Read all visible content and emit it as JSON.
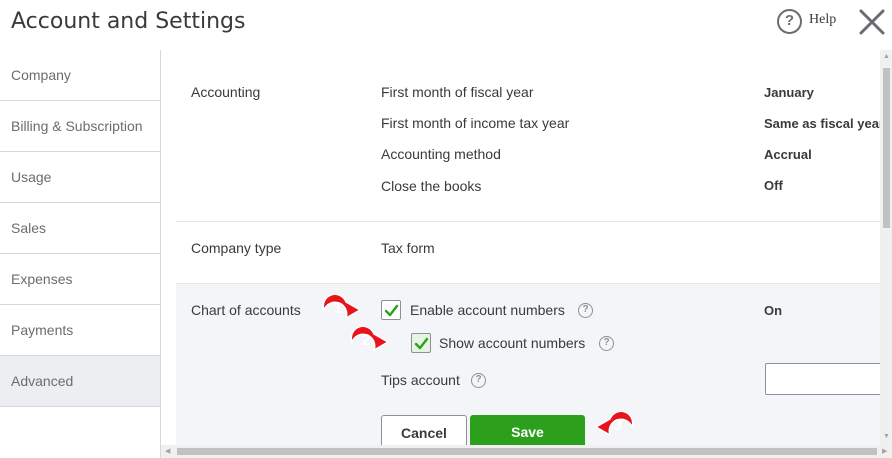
{
  "header": {
    "title": "Account and Settings",
    "help_label": "Help",
    "help_icon": "?",
    "close_icon": "close-icon"
  },
  "sidebar": {
    "items": [
      {
        "label": "Company"
      },
      {
        "label": "Billing & Subscription"
      },
      {
        "label": "Usage"
      },
      {
        "label": "Sales"
      },
      {
        "label": "Expenses"
      },
      {
        "label": "Payments"
      },
      {
        "label": "Advanced",
        "active": true
      }
    ]
  },
  "accounting": {
    "section_label": "Accounting",
    "rows": [
      {
        "label": "First month of fiscal year",
        "value": "January"
      },
      {
        "label": "First month of income tax year",
        "value": "Same as fiscal year"
      },
      {
        "label": "Accounting method",
        "value": "Accrual"
      },
      {
        "label": "Close the books",
        "value": "Off"
      }
    ]
  },
  "company_type": {
    "section_label": "Company type",
    "field_label": "Tax form"
  },
  "chart_of_accounts": {
    "section_label": "Chart of accounts",
    "enable_label": "Enable account numbers",
    "enable_checked": true,
    "status_value": "On",
    "show_label": "Show account numbers",
    "show_checked": true,
    "tips_label": "Tips account",
    "tips_value": "",
    "cancel_label": "Cancel",
    "save_label": "Save"
  },
  "annotations": [
    "1",
    "2",
    "3"
  ],
  "colors": {
    "save_green": "#2ca01c",
    "marker_red": "#e8141b",
    "checkmark_green": "#2ca01c"
  }
}
